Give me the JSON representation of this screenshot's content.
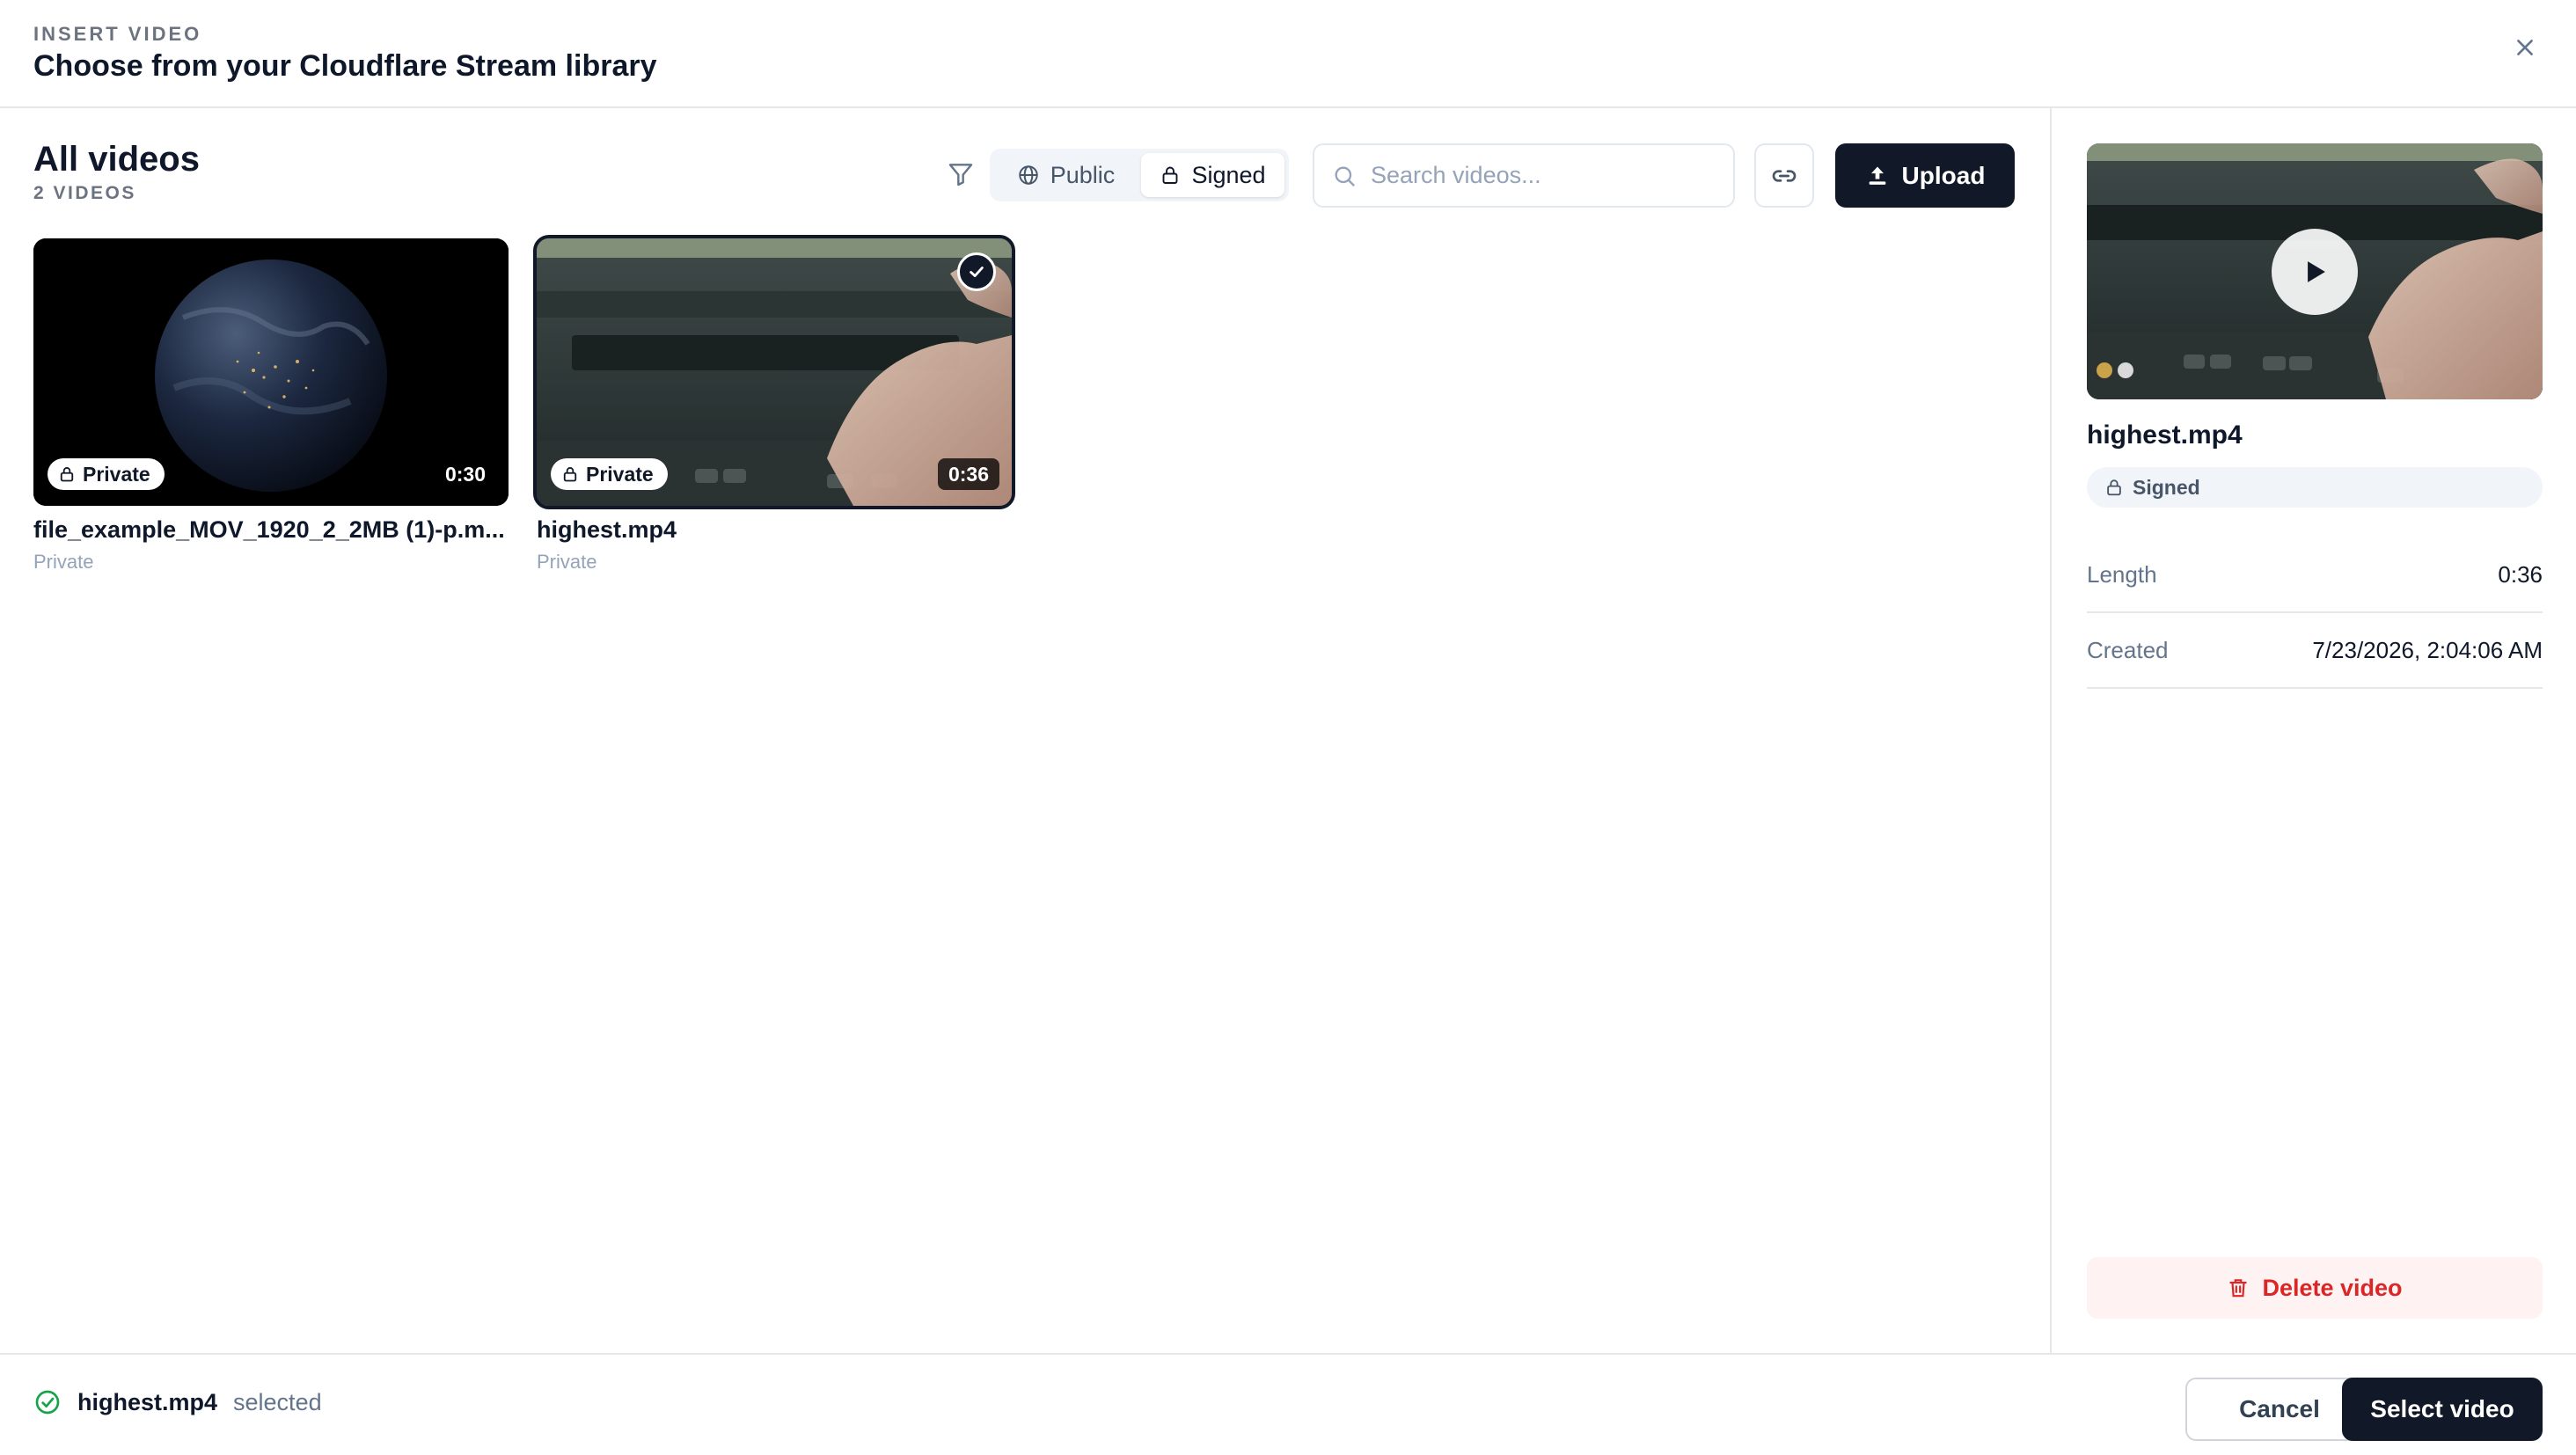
{
  "header": {
    "eyebrow": "INSERT VIDEO",
    "title": "Choose from your Cloudflare Stream library",
    "close_icon": "close-icon"
  },
  "library": {
    "title": "All videos",
    "count": "2 VIDEOS",
    "filter_icon": "filter-icon",
    "segments": [
      {
        "label": "Public",
        "icon": "globe-icon",
        "active": false
      },
      {
        "label": "Signed",
        "icon": "lock-icon",
        "active": true
      }
    ],
    "search": {
      "placeholder": "Search videos...",
      "value": ""
    },
    "link_icon": "link-icon",
    "upload_label": "Upload"
  },
  "videos": [
    {
      "name": "file_example_MOV_1920_2_2MB (1)-p.m...",
      "visibility": "Private",
      "badge": "Private",
      "duration": "0:30",
      "selected": false
    },
    {
      "name": "highest.mp4",
      "visibility": "Private",
      "badge": "Private",
      "duration": "0:36",
      "selected": true
    }
  ],
  "details": {
    "name": "highest.mp4",
    "access": "Signed",
    "meta": [
      {
        "label": "Length",
        "value": "0:36"
      },
      {
        "label": "Created",
        "value": "7/23/2026, 2:04:06 AM"
      }
    ],
    "delete_label": "Delete video"
  },
  "footer": {
    "selected_name": "highest.mp4",
    "selected_word": "selected",
    "cancel_label": "Cancel",
    "select_label": "Select video"
  },
  "colors": {
    "primary": "#111827",
    "danger": "#dc2626",
    "success": "#16a34a",
    "muted": "#94a3b8"
  }
}
